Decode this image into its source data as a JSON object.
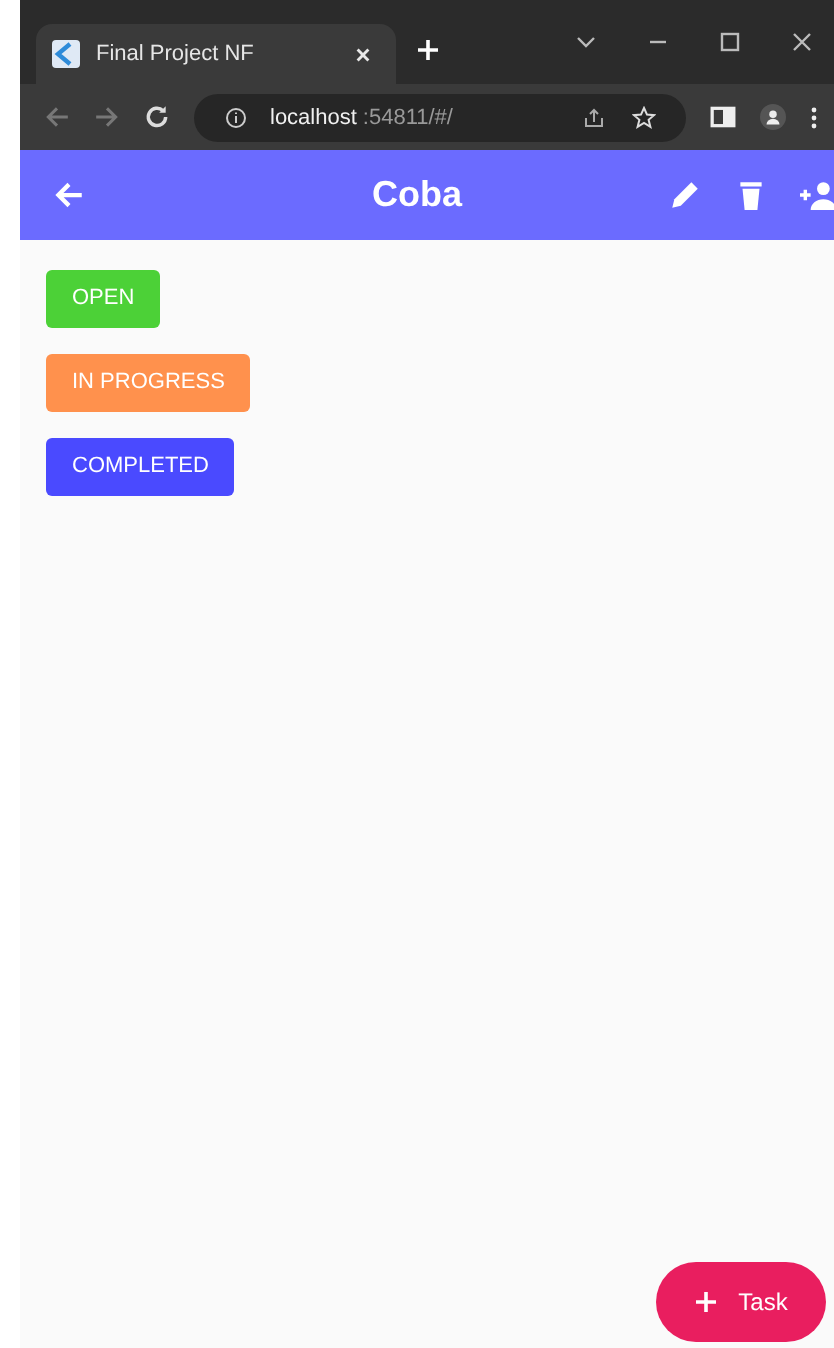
{
  "browser": {
    "tab_title": "Final Project NF",
    "url_host": "localhost",
    "url_rest": ":54811/#/"
  },
  "app_bar": {
    "title": "Coba"
  },
  "status_buttons": [
    {
      "label": "OPEN",
      "color": "#4cd137"
    },
    {
      "label": "IN PROGRESS",
      "color": "#ff914d"
    },
    {
      "label": "COMPLETED",
      "color": "#4a4aff"
    }
  ],
  "fab": {
    "label": "Task"
  }
}
